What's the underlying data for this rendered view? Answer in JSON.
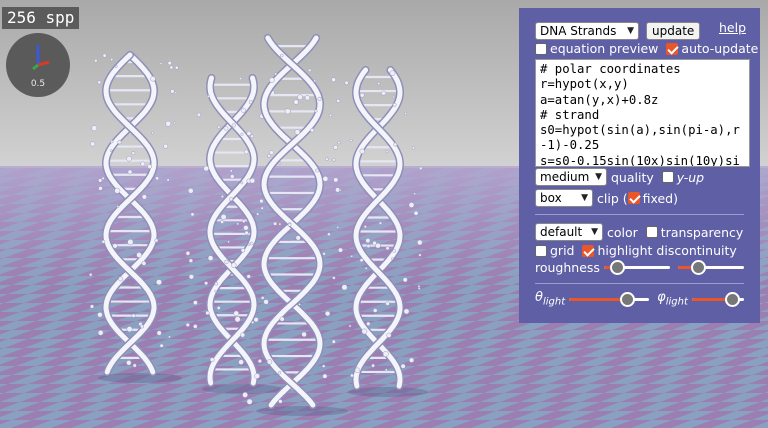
{
  "render": {
    "spp_label": "256 spp",
    "gizmo_scale": "0.5"
  },
  "panel": {
    "preset_select": "DNA Strands",
    "update_label": "update",
    "help_label": "help",
    "equation_preview": {
      "label": "equation preview",
      "checked": false
    },
    "auto_update": {
      "label": "auto-update",
      "checked": true
    },
    "code_lines": [
      "# polar coordinates",
      "r=hypot(x,y)",
      "a=atan(y,x)+0.8z",
      "# strand",
      "s0=hypot(sin(a),sin(pi-a),r",
      "-1)-0.25",
      "s=s0-0.15sin(10x)sin(10y)si"
    ],
    "quality_select": "medium",
    "quality_label": "quality",
    "y_up": {
      "label": "y-up",
      "checked": false
    },
    "clip_select": "box",
    "clip_label": "clip (",
    "fixed": {
      "label": "fixed",
      "checked": true
    },
    "fixed_close": ")",
    "color_select": "default",
    "color_label": "color",
    "transparency": {
      "label": "transparency",
      "checked": false
    },
    "grid": {
      "label": "grid",
      "checked": false
    },
    "highlight_discontinuity": {
      "label": "highlight discontinuity",
      "checked": true
    },
    "roughness_label": "roughness",
    "roughness_slider_1": 0.2,
    "roughness_slider_2": 0.3,
    "theta_label": "θ",
    "theta_sub": "light",
    "theta_slider": 0.72,
    "phi_label": "φ",
    "phi_sub": "light",
    "phi_slider": 0.78
  },
  "colors": {
    "panel_bg": "#5f5fa5",
    "accent": "#e8562a",
    "floor_light": "#8aa0c0",
    "floor_dark": "#9c7fb2"
  }
}
